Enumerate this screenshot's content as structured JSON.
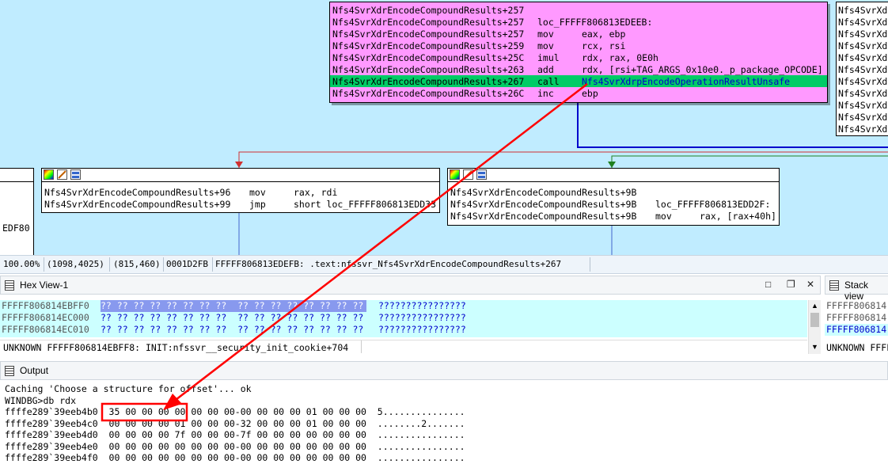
{
  "graph": {
    "top_node": {
      "lines": [
        {
          "addr": "Nfs4SvrXdrEncodeCompoundResults+257",
          "mn": "",
          "ops": ""
        },
        {
          "addr": "Nfs4SvrXdrEncodeCompoundResults+257",
          "mn": "loc_FFFFF806813EDEEB:",
          "ops": ""
        },
        {
          "addr": "Nfs4SvrXdrEncodeCompoundResults+257",
          "mn": "mov",
          "ops": "eax, ebp"
        },
        {
          "addr": "Nfs4SvrXdrEncodeCompoundResults+259",
          "mn": "mov",
          "ops": "rcx, rsi"
        },
        {
          "addr": "Nfs4SvrXdrEncodeCompoundResults+25C",
          "mn": "imul",
          "ops": "rdx, rax, 0E0h"
        },
        {
          "addr": "Nfs4SvrXdrEncodeCompoundResults+263",
          "mn": "add",
          "ops": "rdx, [rsi+TAG_ARGS_0x10e0._p_package_OPCODE]"
        },
        {
          "addr": "Nfs4SvrXdrEncodeCompoundResults+267",
          "mn": "call",
          "ops": "Nfs4SvrXdrpEncodeOperationResultUnsafe"
        },
        {
          "addr": "Nfs4SvrXdrEncodeCompoundResults+26C",
          "mn": "inc",
          "ops": "ebp"
        }
      ]
    },
    "right_node": {
      "lines": [
        "Nfs4SvrXd",
        "Nfs4SvrXd",
        "Nfs4SvrXd",
        "Nfs4SvrXd",
        "Nfs4SvrXd",
        "Nfs4SvrXd",
        "Nfs4SvrXd",
        "Nfs4SvrXd",
        "Nfs4SvrXd",
        "Nfs4SvrXd",
        "Nfs4SvrXd"
      ]
    },
    "left_node": {
      "lines": [
        {
          "addr": "Nfs4SvrXdrEncodeCompoundResults+96",
          "mn": "mov",
          "ops": "rax, rdi"
        },
        {
          "addr": "Nfs4SvrXdrEncodeCompoundResults+99",
          "mn": "jmp",
          "ops": "short loc_FFFFF806813EDD33"
        }
      ]
    },
    "mid_node": {
      "lines": [
        {
          "addr": "Nfs4SvrXdrEncodeCompoundResults+9B",
          "mn": "",
          "ops": ""
        },
        {
          "addr": "Nfs4SvrXdrEncodeCompoundResults+9B",
          "mn": "loc_FFFFF806813EDD2F:",
          "ops": ""
        },
        {
          "addr": "Nfs4SvrXdrEncodeCompoundResults+9B",
          "mn": "mov",
          "ops": "rax, [rax+40h]"
        }
      ]
    },
    "edge_fragment": "EDF80"
  },
  "status_bar": {
    "zoom": "100.00%",
    "coords": "(1098,4025)",
    "pos": "(815,460)",
    "offset": "0001D2FB",
    "location": "FFFFF806813EDEFB: .text:nfssvr_Nfs4SvrXdrEncodeCompoundResults+267"
  },
  "hex_view": {
    "title": "Hex View-1",
    "rows": [
      {
        "addr": "FFFFF806814EBFF0",
        "bytes": "?? ?? ?? ?? ?? ?? ?? ??  ?? ?? ?? ?? ?? ?? ?? ??",
        "ascii": "????????????????"
      },
      {
        "addr": "FFFFF806814EC000",
        "bytes": "?? ?? ?? ?? ?? ?? ?? ??  ?? ?? ?? ?? ?? ?? ?? ??",
        "ascii": "????????????????"
      },
      {
        "addr": "FFFFF806814EC010",
        "bytes": "?? ?? ?? ?? ?? ?? ?? ??  ?? ?? ?? ?? ?? ?? ?? ??",
        "ascii": "????????????????"
      }
    ],
    "footer": "UNKNOWN FFFFF806814EBFF8: INIT:nfssvr__security_init_cookie+704"
  },
  "stack_view": {
    "title": "Stack view",
    "rows": [
      "FFFFF806814",
      "FFFFF806814",
      "FFFFF806814"
    ],
    "footer": "UNKNOWN FFFF"
  },
  "output": {
    "title": "Output",
    "lines": [
      "Caching 'Choose a structure for offset'... ok",
      "WINDBG>db rdx",
      "ffffe289`39eeb4b0  35 00 00 00 00 00 00 00-00 00 00 00 01 00 00 00  5...............",
      "ffffe289`39eeb4c0  00 00 00 00 01 00 00 00-32 00 00 00 01 00 00 00  ........2.......",
      "ffffe289`39eeb4d0  00 00 00 00 7f 00 00 00-7f 00 00 00 00 00 00 00  ................",
      "ffffe289`39eeb4e0  00 00 00 00 00 00 00 00-00 00 00 00 00 00 00 00  ................",
      "ffffe289`39eeb4f0  00 00 00 00 00 00 00 00-00 00 00 00 00 00 00 00  ................"
    ]
  },
  "colors": {
    "graph_bg": "#c0ecff",
    "node_pink": "#ff99ff",
    "node_pink_dark": "#e680e6",
    "call_highlight": "#00cc66",
    "register": "#ffbb66",
    "annotation_red": "#ff0000"
  }
}
